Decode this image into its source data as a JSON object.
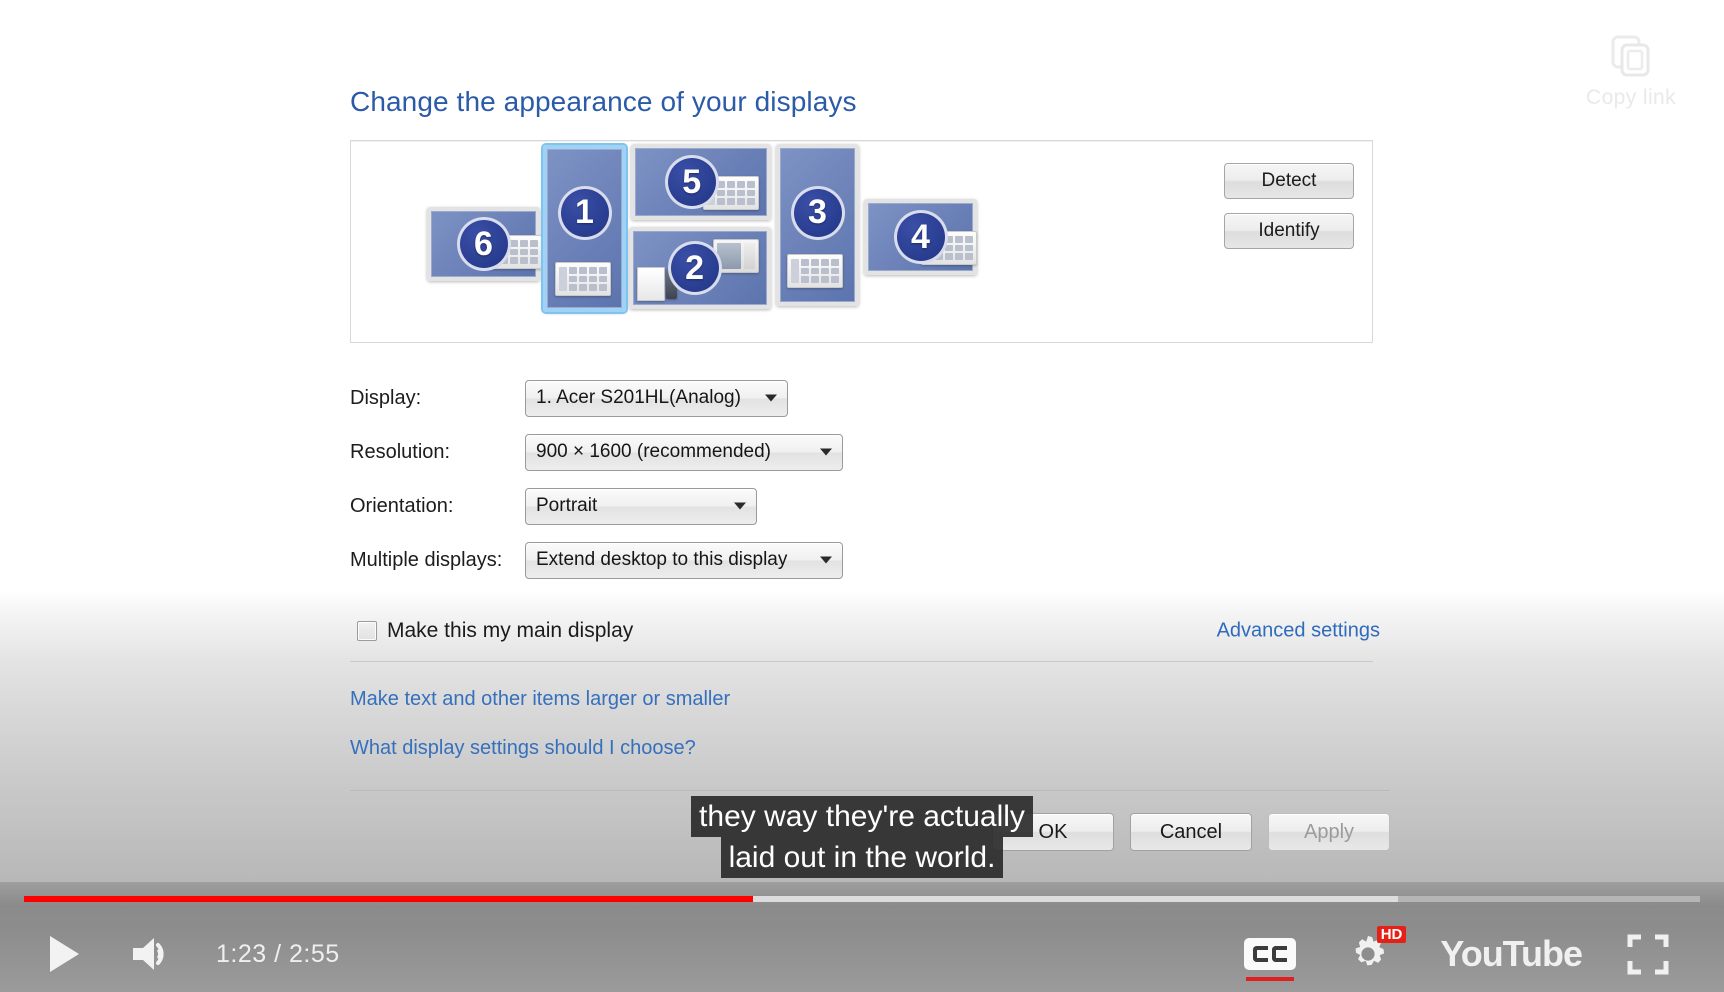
{
  "watermark": {
    "label": "Copy link",
    "icon": "copy-icon"
  },
  "control_panel": {
    "title": "Change the appearance of your displays",
    "monitors": [
      {
        "number": "6",
        "selected": false
      },
      {
        "number": "1",
        "selected": true
      },
      {
        "number": "5",
        "selected": false
      },
      {
        "number": "2",
        "selected": false
      },
      {
        "number": "3",
        "selected": false
      },
      {
        "number": "4",
        "selected": false
      }
    ],
    "side_buttons": [
      {
        "label": "Detect"
      },
      {
        "label": "Identify"
      }
    ],
    "fields": [
      {
        "label": "Display:",
        "value": "1. Acer S201HL(Analog)"
      },
      {
        "label": "Resolution:",
        "value": "900 × 1600 (recommended)"
      },
      {
        "label": "Orientation:",
        "value": "Portrait"
      },
      {
        "label": "Multiple displays:",
        "value": "Extend desktop to this display"
      }
    ],
    "main_display_checkbox": {
      "label": "Make this my main display",
      "checked": false
    },
    "advanced_link": "Advanced settings",
    "links": [
      "Make text and other items larger or smaller",
      "What display settings should I choose?"
    ],
    "buttons": [
      {
        "label": "OK",
        "enabled": true
      },
      {
        "label": "Cancel",
        "enabled": true
      },
      {
        "label": "Apply",
        "enabled": false
      }
    ]
  },
  "captions": {
    "lines": [
      "they way they're actually",
      "laid out in the world."
    ]
  },
  "player": {
    "current_time": "1:23",
    "duration": "2:55",
    "time_display": "1:23 / 2:55",
    "played_percent": 43.5,
    "buffered_percent": 82.0,
    "progress_color": "#ff0000",
    "play_icon": "play-icon",
    "volume_icon": "volume-icon",
    "cc_label": "CC",
    "cc_enabled": true,
    "quality_badge": "HD",
    "settings_icon": "gear-icon",
    "logo_text": "YouTube",
    "fullscreen_icon": "fullscreen-icon"
  }
}
